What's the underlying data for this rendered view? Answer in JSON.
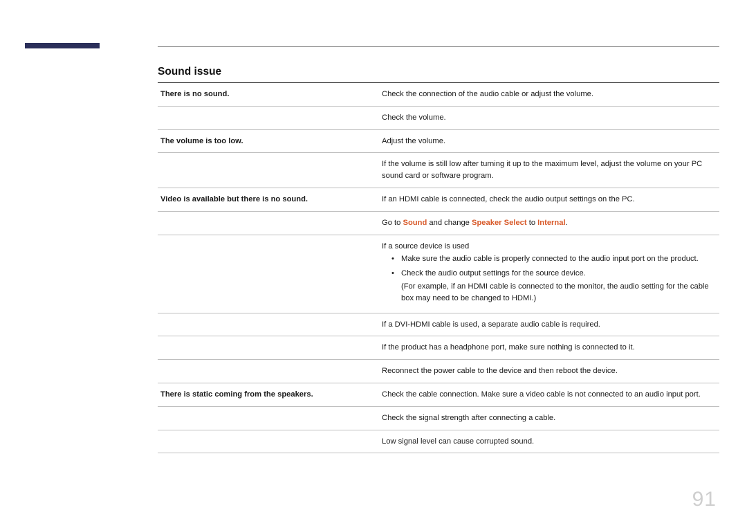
{
  "page_number": "91",
  "section_title": "Sound issue",
  "rows": [
    {
      "label": "There is no sound.",
      "cells": [
        "Check the connection of the audio cable or adjust the volume.",
        "Check the volume."
      ]
    },
    {
      "label": "The volume is too low.",
      "cells": [
        "Adjust the volume.",
        "If the volume is still low after turning it up to the maximum level, adjust the volume on your PC sound card or software program."
      ]
    },
    {
      "label": "Video is available but there is no sound.",
      "cells": [
        "If an HDMI cable is connected, check the audio output settings on the PC.",
        {
          "type": "rich",
          "parts": [
            "Go to ",
            {
              "hl": "Sound"
            },
            " and change ",
            {
              "hl": "Speaker Select"
            },
            " to ",
            {
              "hl": "Internal"
            },
            "."
          ]
        },
        {
          "type": "block",
          "lead": "If a source device is used",
          "bullets": [
            {
              "text": "Make sure the audio cable is properly connected to the audio input port on the product."
            },
            {
              "text": "Check the audio output settings for the source device.",
              "sub": "(For example, if an HDMI cable is connected to the monitor, the audio setting for the cable box may need to be changed to HDMI.)"
            }
          ]
        },
        "If a DVI-HDMI cable is used, a separate audio cable is required.",
        "If the product has a headphone port, make sure nothing is connected to it.",
        "Reconnect the power cable to the device and then reboot the device."
      ]
    },
    {
      "label": "There is static coming from the speakers.",
      "cells": [
        "Check the cable connection. Make sure a video cable is not connected to an audio input port.",
        "Check the signal strength after connecting a cable.",
        "Low signal level can cause corrupted sound."
      ]
    }
  ]
}
